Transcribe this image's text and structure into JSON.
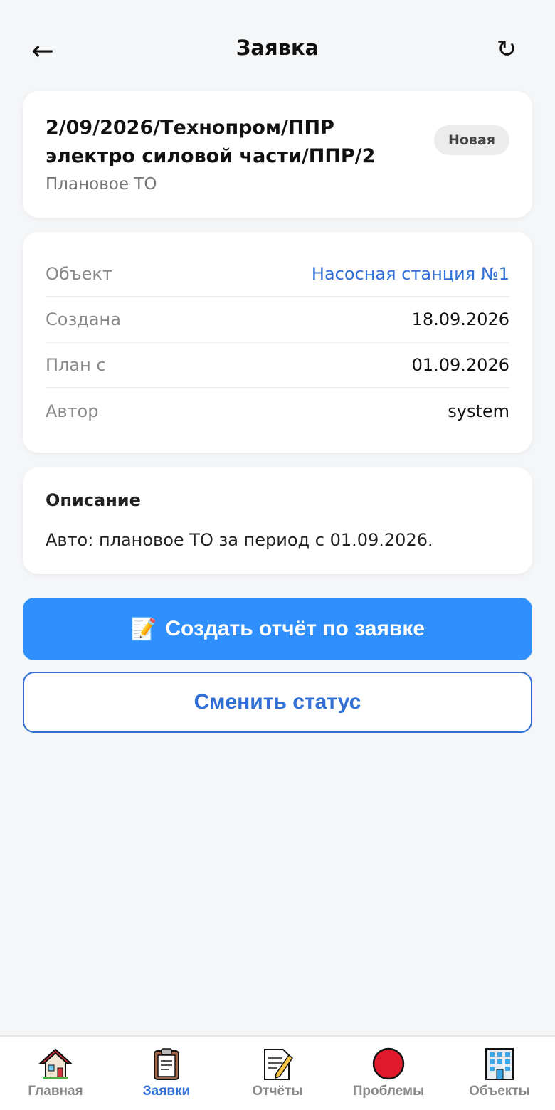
{
  "header": {
    "title": "Заявка",
    "back_icon": "←",
    "refresh_icon": "↻"
  },
  "request": {
    "title": "2/09/2026/Технопром/ППР электро силовой части/ППР/2",
    "type": "Плановое ТО",
    "status": "Новая"
  },
  "info": {
    "rows": [
      {
        "label": "Объект",
        "value": "Насосная станция №1"
      },
      {
        "label": "Создана",
        "value": "18.09.2026"
      },
      {
        "label": "План с",
        "value": "01.09.2026"
      },
      {
        "label": "Автор",
        "value": "system"
      }
    ]
  },
  "description": {
    "heading": "Описание",
    "text": "Авто: плановое ТО за период с 01.09.2026."
  },
  "actions": {
    "create_report_emoji": "📝",
    "create_report_label": "Создать отчёт по заявке",
    "change_status_label": "Сменить статус"
  },
  "nav": {
    "items": [
      {
        "label": "Главная",
        "icon": "home-icon"
      },
      {
        "label": "Заявки",
        "icon": "clipboard-icon",
        "active": true
      },
      {
        "label": "Отчёты",
        "icon": "memo-icon"
      },
      {
        "label": "Проблемы",
        "icon": "red-circle-icon"
      },
      {
        "label": "Объекты",
        "icon": "building-icon"
      }
    ]
  },
  "colors": {
    "accent": "#2f8ffd",
    "link": "#2f6fd6",
    "background": "#f5f6f8"
  }
}
